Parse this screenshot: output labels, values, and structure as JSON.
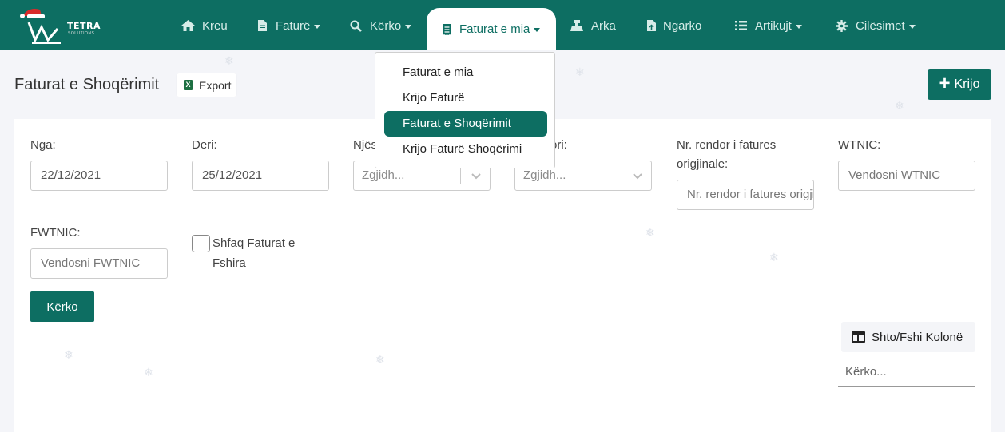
{
  "brand": {
    "name": "TETRA",
    "sub": "SOLUTIONS"
  },
  "nav": [
    {
      "label": "Kreu",
      "icon": "home-icon",
      "caret": false
    },
    {
      "label": "Faturë",
      "icon": "file-icon",
      "caret": true
    },
    {
      "label": "Kërko",
      "icon": "search-icon",
      "caret": true
    },
    {
      "label": "Faturat e mia",
      "icon": "receipt-icon",
      "caret": true,
      "active": true
    },
    {
      "label": "Arka",
      "icon": "cash-register-icon",
      "caret": false
    },
    {
      "label": "Ngarko",
      "icon": "file-upload-icon",
      "caret": false
    },
    {
      "label": "Artikujt",
      "icon": "list-icon",
      "caret": true
    },
    {
      "label": "Cilësimet",
      "icon": "gear-icon",
      "caret": true
    }
  ],
  "dropdown": [
    {
      "label": "Faturat e mia"
    },
    {
      "label": "Krijo Faturë"
    },
    {
      "label": "Faturat e Shoqërimit",
      "selected": true
    },
    {
      "label": "Krijo Faturë Shoqërimi"
    }
  ],
  "page": {
    "title": "Faturat e Shoqërimit",
    "export_label": "Export",
    "create_label": "Krijo"
  },
  "filters": {
    "from_label": "Nga:",
    "from_value": "22/12/2021",
    "to_label": "Deri:",
    "to_value": "25/12/2021",
    "unit_label": "Njësi",
    "unit_placeholder": "Zgjidh...",
    "operator_label": "ori:",
    "operator_placeholder": "Zgjidh...",
    "orig_label": "Nr. rendor i fatures origjinale:",
    "orig_placeholder": "Nr. rendor i fatures origjinale",
    "wtnic_label": "WTNIC:",
    "wtnic_placeholder": "Vendosni WTNIC",
    "fwtnic_label": "FWTNIC:",
    "fwtnic_placeholder": "Vendosni FWTNIC",
    "deleted_label": "Shfaq Faturat e Fshira",
    "search_button": "Kërko"
  },
  "table_tools": {
    "columns_label": "Shto/Fshi Kolonë",
    "search_placeholder": "Kërko..."
  },
  "colors": {
    "primary": "#0d6e62",
    "background": "#f4f5f9"
  }
}
